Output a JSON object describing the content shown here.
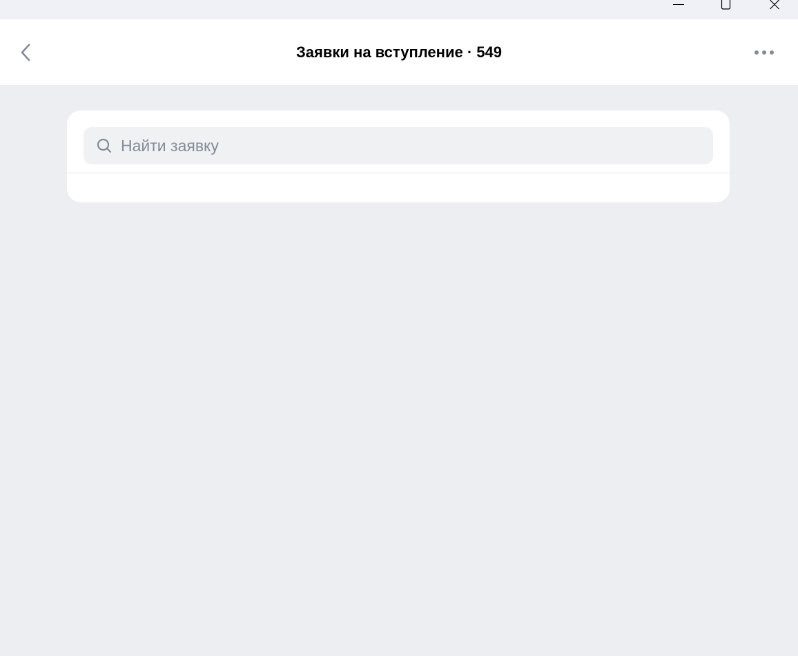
{
  "window": {
    "minimize_icon": "minimize-icon",
    "maximize_icon": "maximize-icon",
    "close_icon": "close-icon"
  },
  "header": {
    "title": "Заявки на вступление · 549",
    "back_icon": "chevron-left-icon",
    "more_icon": "more-horizontal-icon"
  },
  "search": {
    "placeholder": "Найти заявку",
    "value": "",
    "icon": "search-icon"
  },
  "colors": {
    "background": "#edeef2",
    "header_bg": "#ffffff",
    "search_bg": "#f0f1f2",
    "placeholder": "#818c99",
    "icon": "#818c99"
  }
}
